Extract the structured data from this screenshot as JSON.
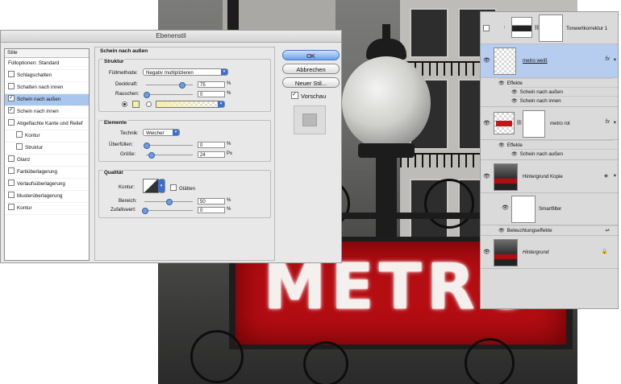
{
  "dialog": {
    "title": "Ebenenstil",
    "list_header": "Stile",
    "list_items": [
      {
        "label": "Fülloptionen: Standard",
        "checkbox": false,
        "checked": false,
        "indent": false,
        "active": false
      },
      {
        "label": "Schlagschatten",
        "checkbox": true,
        "checked": false,
        "indent": false,
        "active": false
      },
      {
        "label": "Schatten nach innen",
        "checkbox": true,
        "checked": false,
        "indent": false,
        "active": false
      },
      {
        "label": "Schein nach außen",
        "checkbox": true,
        "checked": true,
        "indent": false,
        "active": true
      },
      {
        "label": "Schein nach innen",
        "checkbox": true,
        "checked": true,
        "indent": false,
        "active": false
      },
      {
        "label": "Abgeflachte Kante und Relief",
        "checkbox": true,
        "checked": false,
        "indent": false,
        "active": false
      },
      {
        "label": "Kontur",
        "checkbox": true,
        "checked": false,
        "indent": true,
        "active": false
      },
      {
        "label": "Struktur",
        "checkbox": true,
        "checked": false,
        "indent": true,
        "active": false
      },
      {
        "label": "Glanz",
        "checkbox": true,
        "checked": false,
        "indent": false,
        "active": false
      },
      {
        "label": "Farbüberlagerung",
        "checkbox": true,
        "checked": false,
        "indent": false,
        "active": false
      },
      {
        "label": "Verlaufsüberlagerung",
        "checkbox": true,
        "checked": false,
        "indent": false,
        "active": false
      },
      {
        "label": "Musterüberlagerung",
        "checkbox": true,
        "checked": false,
        "indent": false,
        "active": false
      },
      {
        "label": "Kontur",
        "checkbox": true,
        "checked": false,
        "indent": false,
        "active": false
      }
    ],
    "pane_title": "Schein nach außen",
    "struktur": {
      "title": "Struktur",
      "blend_label": "Füllmethode:",
      "blend_value": "Negativ multiplizieren",
      "opacity_label": "Deckkraft:",
      "opacity_value": "75",
      "opacity_level": 0.75,
      "noise_label": "Rauschen:",
      "noise_value": "0",
      "noise_level": 0,
      "unit_percent": "%"
    },
    "elemente": {
      "title": "Elemente",
      "technique_label": "Technik:",
      "technique_value": "Weicher",
      "spread_label": "Überfüllen:",
      "spread_value": "0",
      "spread_level": 0,
      "size_label": "Größe:",
      "size_value": "24",
      "size_level": 0.1,
      "unit_percent": "%",
      "unit_px": "Px"
    },
    "qualitaet": {
      "title": "Qualität",
      "contour_label": "Kontur:",
      "antialias_label": "Glätten",
      "range_label": "Bereich:",
      "range_value": "50",
      "range_level": 0.5,
      "jitter_label": "Zufallswert:",
      "jitter_value": "0",
      "jitter_level": 0,
      "unit_percent": "%"
    },
    "buttons": {
      "ok": "OK",
      "cancel": "Abbrechen",
      "new_style": "Neuer Stil...",
      "preview": "Vorschau"
    },
    "glow_color": "#f6efa6"
  },
  "layers": {
    "top_layer": "Tonwertkorrektur 1",
    "metro_white": "metro weiß",
    "effects_label": "Effekte",
    "effect_outer": "Schein nach außen",
    "effect_inner": "Schein nach innen",
    "metro_red": "metro rot",
    "effect_outer_2": "Schein nach außen",
    "bg_copy": "Hintergrund Kopie",
    "smartfilter": "Smartfilter",
    "lighting": "Beleuchtungseffekte",
    "background": "Hintergrund",
    "fx": "fx",
    "selection_color": "#b6cdf0"
  },
  "photo": {
    "sign_text": "METRO",
    "sign_color": "#b40d12"
  }
}
